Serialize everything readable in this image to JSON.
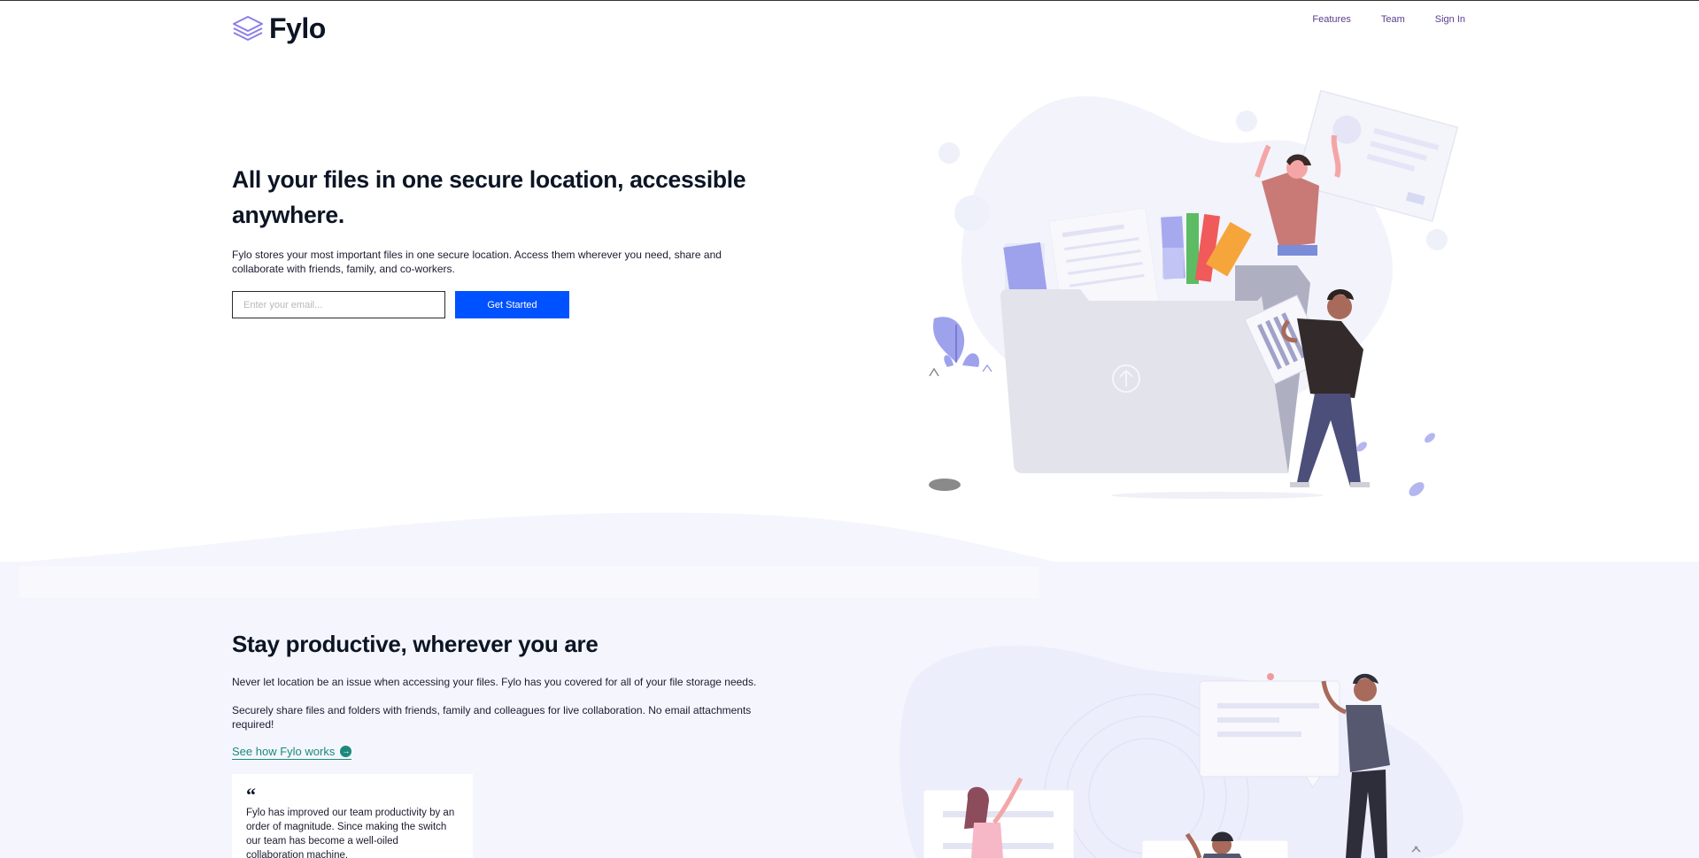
{
  "header": {
    "brand": "Fylo",
    "nav": [
      {
        "label": "Features"
      },
      {
        "label": "Team"
      },
      {
        "label": "Sign In"
      }
    ]
  },
  "hero": {
    "title": "All your files in one secure location, accessible anywhere.",
    "description": "Fylo stores your most important files in one secure location. Access them wherever you need, share and collaborate with friends, family, and co-workers.",
    "email_placeholder": "Enter your email...",
    "cta_label": "Get Started"
  },
  "productive": {
    "title": "Stay productive, wherever you are",
    "paragraph1": "Never let location be an issue when accessing your files. Fylo has you covered for all of your file storage needs.",
    "paragraph2": "Securely share files and folders with friends, family and colleagues for live collaboration. No email attachments required!",
    "link_label": "See how Fylo works",
    "testimonial": {
      "quote_mark": "“",
      "text": "Fylo has improved our team productivity by an order of magnitude. Since making the switch our team has become a well-oiled collaboration machine."
    }
  },
  "colors": {
    "accent": "#0051ff",
    "nav_text": "#5b3c8c",
    "link": "#1b8a7a",
    "section_bg": "#f5f6fd"
  },
  "icons": [
    "layers-logo-icon",
    "arrow-right-circle-icon",
    "quote-icon"
  ]
}
